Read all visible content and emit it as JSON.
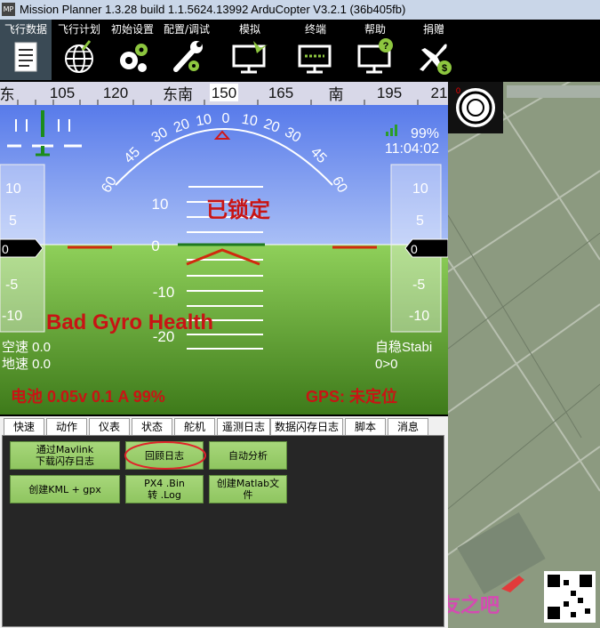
{
  "window": {
    "title": "Mission Planner 1.3.28 build 1.1.5624.13992 ArduCopter V3.2.1 (36b405fb)",
    "icon_text": "MP"
  },
  "menu": [
    {
      "label": "飞行数据",
      "icon": "flight-data-icon"
    },
    {
      "label": "飞行计划",
      "icon": "globe-icon"
    },
    {
      "label": "初始设置",
      "icon": "gears-icon"
    },
    {
      "label": "配置/调试",
      "icon": "wrench-icon"
    },
    {
      "label": "模拟",
      "icon": "monitor-plane-icon"
    },
    {
      "label": "终端",
      "icon": "terminal-icon"
    },
    {
      "label": "帮助",
      "icon": "help-monitor-icon"
    },
    {
      "label": "捐赠",
      "icon": "plane-dollar-icon"
    }
  ],
  "hud": {
    "heading_tape": [
      "东",
      "105",
      "120",
      "东南",
      "150",
      "165",
      "南",
      "195",
      "21"
    ],
    "roll_scale": [
      "60",
      "45",
      "30",
      "20",
      "10",
      "0",
      "10",
      "20",
      "30",
      "45",
      "60"
    ],
    "pitch_labels": [
      "10",
      "0",
      "-10",
      "-20"
    ],
    "speed_scale": [
      "10",
      "5",
      "-5",
      "-10"
    ],
    "speed_value": "0",
    "alt_scale": [
      "10",
      "5",
      "-5",
      "-10"
    ],
    "alt_value": "0",
    "battery_pct": "99%",
    "time": "11:04:02",
    "status": "已锁定",
    "warning": "Bad Gyro Health",
    "airspeed": "空速 0.0",
    "groundspeed": "地速 0.0",
    "mode": "自稳Stabi",
    "wp": "0>0",
    "battery": "电池 0.05v 0.1 A 99%",
    "gps": "GPS: 未定位",
    "colors": {
      "sky": "#6d8ff0",
      "ground": "#7fc14a",
      "accent": "#c81414"
    }
  },
  "tabs": [
    "快速",
    "动作",
    "仪表",
    "状态",
    "舵机",
    "遥测日志",
    "数据闪存日志",
    "脚本",
    "消息"
  ],
  "active_tab": "数据闪存日志",
  "buttons": {
    "download": "通过Mavlink\n下载闪存日志",
    "review": "回顾日志",
    "auto_analysis": "自动分析",
    "kml": "创建KML + gpx",
    "px4": "PX4 .Bin\n转 .Log",
    "matlab": "创建Matlab文\n件"
  },
  "map": {
    "compass_value": "0",
    "marker_value": "0"
  },
  "watermark": {
    "text": "模友之吧"
  }
}
